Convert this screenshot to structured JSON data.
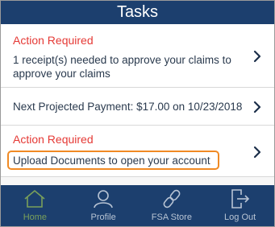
{
  "header": {
    "title": "Tasks"
  },
  "tasks": [
    {
      "status": "Action Required",
      "line1": "1 receipt(s) needed to approve your claims to",
      "line2": "approve your claims",
      "chevron_icon": "chevron-right-icon"
    },
    {
      "text": "Next Projected Payment: $17.00 on 10/23/2018",
      "chevron_icon": "chevron-right-icon"
    },
    {
      "status": "Action Required",
      "text": "Upload Documents to open your account",
      "chevron_icon": "chevron-right-icon"
    }
  ],
  "tabbar": {
    "tabs": [
      {
        "label": "Home",
        "icon": "home-icon",
        "active": true
      },
      {
        "label": "Profile",
        "icon": "profile-icon",
        "active": false
      },
      {
        "label": "FSA Store",
        "icon": "link-icon",
        "active": false
      },
      {
        "label": "Log Out",
        "icon": "logout-icon",
        "active": false
      }
    ]
  },
  "colors": {
    "header_bg": "#1c3f6e",
    "action_required": "#e53935",
    "body_text": "#2a3a4e",
    "highlight_border": "#f08a24",
    "tab_active": "#7aa05a",
    "tab_inactive": "#b8c4d4"
  }
}
